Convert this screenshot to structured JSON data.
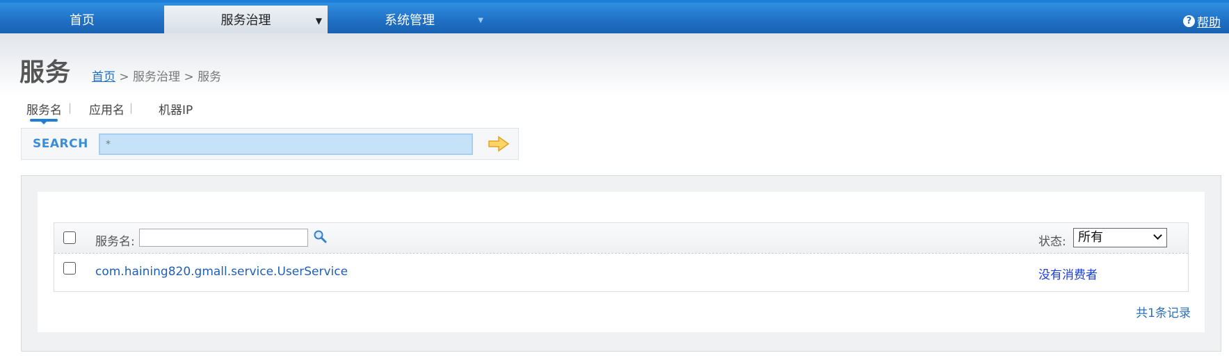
{
  "nav": {
    "items": [
      {
        "label": "首页"
      },
      {
        "label": "服务治理"
      },
      {
        "label": "系统管理"
      }
    ],
    "help_label": "帮助",
    "help_icon": "question-icon",
    "accent": "#1f6fc4"
  },
  "header": {
    "title": "服务",
    "breadcrumb": {
      "home": "首页",
      "rest": " > 服务治理 > 服务"
    }
  },
  "search": {
    "tabs": [
      {
        "label": "服务名"
      },
      {
        "label": "应用名"
      },
      {
        "label": "机器IP"
      }
    ],
    "active_tab": "服务名",
    "label": "SEARCH",
    "value": "*",
    "go_icon": "arrow-right-icon"
  },
  "table": {
    "filter_label": "服务名:",
    "filter_value": "",
    "status_label": "状态:",
    "status_selected": "所有",
    "rows": [
      {
        "service": "com.haining820.gmall.service.UserService",
        "status": "没有消费者"
      }
    ],
    "footer": "共1条记录"
  }
}
